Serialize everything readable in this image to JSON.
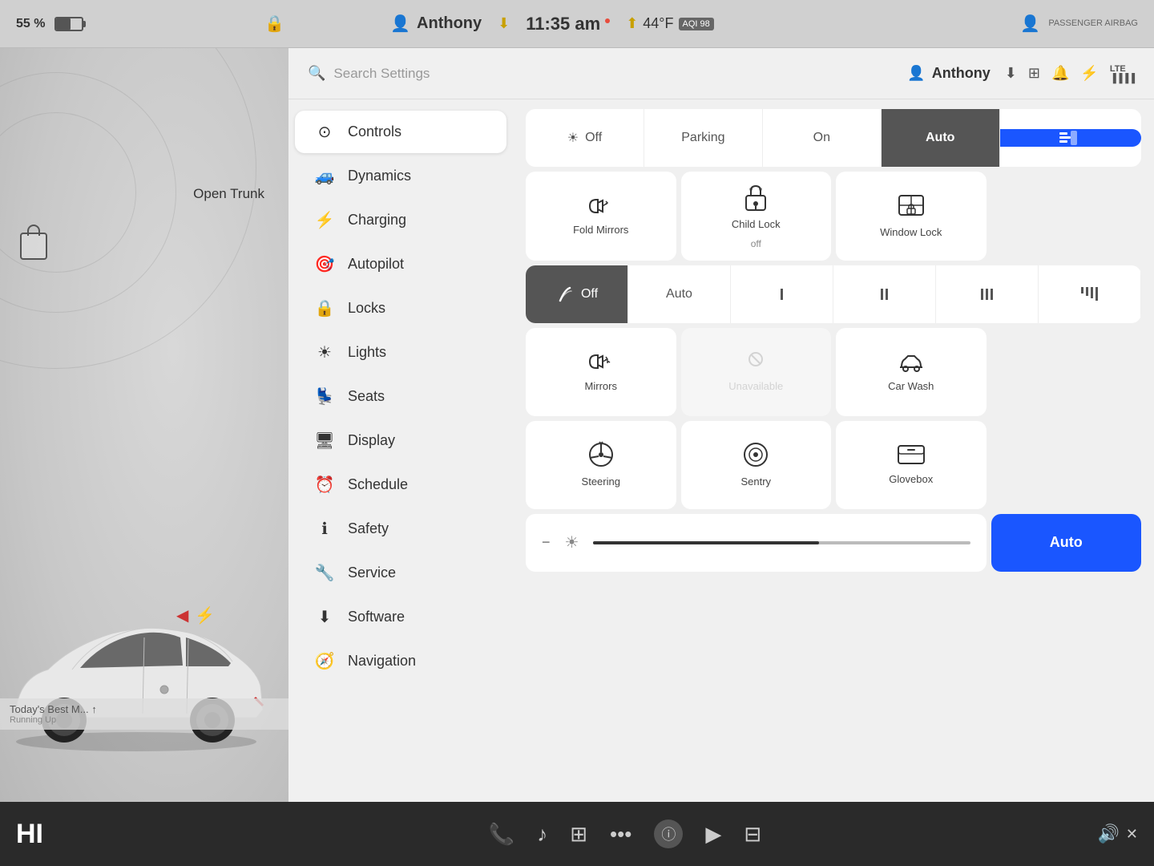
{
  "statusBar": {
    "battery": "55 %",
    "profile": "Anthony",
    "time": "11:35 am",
    "temperature": "44°F",
    "aqi": "AQI 98",
    "passengerAirbag": "PASSENGER AIRBAG"
  },
  "searchBar": {
    "placeholder": "Search Settings"
  },
  "headerUser": {
    "name": "Anthony"
  },
  "navigation": {
    "items": [
      {
        "id": "controls",
        "label": "Controls",
        "icon": "⊙",
        "active": true
      },
      {
        "id": "dynamics",
        "label": "Dynamics",
        "icon": "🚗"
      },
      {
        "id": "charging",
        "label": "Charging",
        "icon": "⚡"
      },
      {
        "id": "autopilot",
        "label": "Autopilot",
        "icon": "🔵"
      },
      {
        "id": "locks",
        "label": "Locks",
        "icon": "🔒"
      },
      {
        "id": "lights",
        "label": "Lights",
        "icon": "☀"
      },
      {
        "id": "seats",
        "label": "Seats",
        "icon": "💺"
      },
      {
        "id": "display",
        "label": "Display",
        "icon": "🖥"
      },
      {
        "id": "schedule",
        "label": "Schedule",
        "icon": "⏰"
      },
      {
        "id": "safety",
        "label": "Safety",
        "icon": "ℹ"
      },
      {
        "id": "service",
        "label": "Service",
        "icon": "🔧"
      },
      {
        "id": "software",
        "label": "Software",
        "icon": "⬇"
      },
      {
        "id": "navigation",
        "label": "Navigation",
        "icon": "🧭"
      }
    ]
  },
  "controls": {
    "lightsOptions": [
      "Off",
      "Parking",
      "On",
      "Auto"
    ],
    "activeLightOption": "Auto",
    "foldMirrors": "Fold Mirrors",
    "childLock": "Child Lock",
    "childLockSub": "off",
    "windowLock": "Window Lock",
    "wiperLabel": "Off",
    "wiperAuto": "Auto",
    "mirrors": "Mirrors",
    "unavailable": "Unavailable",
    "carWash": "Car Wash",
    "steering": "Steering",
    "sentry": "Sentry",
    "glovebox": "Glovebox",
    "brightnessAuto": "Auto",
    "openTrunk": "Open Trunk"
  },
  "taskbar": {
    "hiText": "HI",
    "radioText": "Today's Best M...",
    "upArrow": "↑"
  }
}
